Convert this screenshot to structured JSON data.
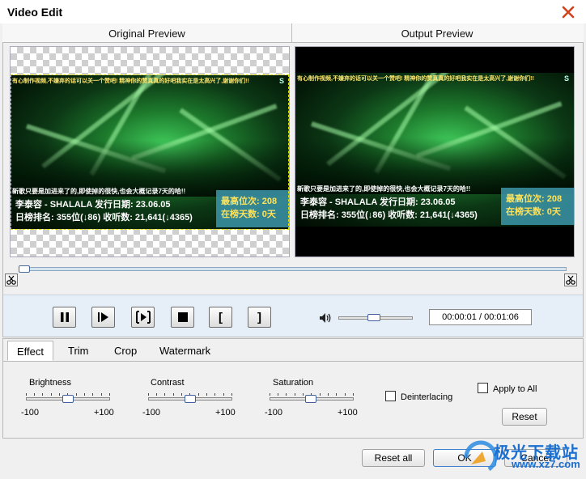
{
  "window": {
    "title": "Video Edit"
  },
  "preview": {
    "original_label": "Original Preview",
    "output_label": "Output Preview",
    "video": {
      "subtitle_top": "有心制作视频,不嫌弃的话可以关一个赞吧!  精神你的赞真真的好吧我实在是太高兴了,谢谢你们!!",
      "subtitle_mid": "新歌只要是加进来了的,即使掉的很快,也会大概记录7天的哈!!",
      "line1": "李泰容 - SHALALA  发行日期: 23.06.05",
      "line2": "日榜排名: 355位(↓86)  收听数: 21,641(↓4365)",
      "stat1": "最高位次: 208",
      "stat2": "在榜天数: 0天",
      "logo": "S"
    }
  },
  "playback": {
    "time": "00:00:01 / 00:01:06",
    "play_pause": "pause-icon",
    "next_frame": "step-forward-icon",
    "frame_mark": "frame-icon",
    "stop": "stop-icon",
    "set_start": "[",
    "set_end": "]",
    "volume_level": 0.45,
    "position": 0.0
  },
  "tabs": [
    "Effect",
    "Trim",
    "Crop",
    "Watermark"
  ],
  "active_tab": "Effect",
  "effect": {
    "brightness": {
      "label": "Brightness",
      "min": "-100",
      "max": "+100",
      "value": 0
    },
    "contrast": {
      "label": "Contrast",
      "min": "-100",
      "max": "+100",
      "value": 0
    },
    "saturation": {
      "label": "Saturation",
      "min": "-100",
      "max": "+100",
      "value": 0
    },
    "deinterlacing": {
      "label": "Deinterlacing",
      "checked": false
    },
    "apply_all": {
      "label": "Apply to All",
      "checked": false
    },
    "reset": "Reset"
  },
  "footer": {
    "reset_all": "Reset all",
    "ok": "OK",
    "cancel": "Cancel"
  },
  "watermark_site": {
    "name": "极光下载站",
    "url": "www.xz7.com"
  },
  "colors": {
    "accent": "#3f61a0",
    "controls_band": "#e6eef8",
    "stat_panel": "#3c96aa",
    "stat_text": "#ffe25a"
  }
}
